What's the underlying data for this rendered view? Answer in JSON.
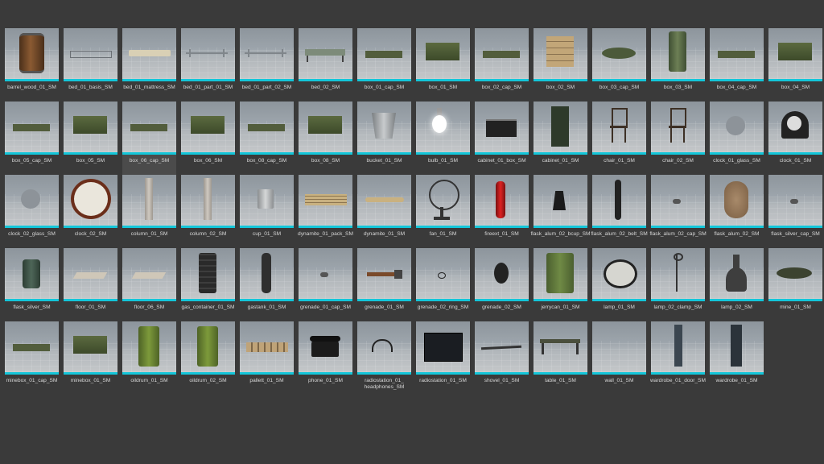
{
  "assets": [
    {
      "label": "barrel_wood_01_SM",
      "icon": "barrel-icon"
    },
    {
      "label": "bed_01_basis_SM",
      "icon": "bed-frame-icon"
    },
    {
      "label": "bed_01_mattress_SM",
      "icon": "mattress-icon"
    },
    {
      "label": "bed_01_part_01_SM",
      "icon": "bed-part-icon"
    },
    {
      "label": "bed_01_part_02_SM",
      "icon": "bed-part-icon"
    },
    {
      "label": "bed_02_SM",
      "icon": "cot-icon"
    },
    {
      "label": "box_01_cap_SM",
      "icon": "box-lid-icon"
    },
    {
      "label": "box_01_SM",
      "icon": "box-icon"
    },
    {
      "label": "box_02_cap_SM",
      "icon": "box-lid-icon"
    },
    {
      "label": "box_02_SM",
      "icon": "wooden-crate-icon"
    },
    {
      "label": "box_03_cap_SM",
      "icon": "round-lid-icon"
    },
    {
      "label": "box_03_SM",
      "icon": "cylinder-case-icon"
    },
    {
      "label": "box_04_cap_SM",
      "icon": "box-lid-icon"
    },
    {
      "label": "box_04_SM",
      "icon": "box-icon"
    },
    {
      "label": "box_05_cap_SM",
      "icon": "box-lid-icon"
    },
    {
      "label": "box_05_SM",
      "icon": "box-icon"
    },
    {
      "label": "box_06_cap_SM",
      "icon": "box-lid-icon"
    },
    {
      "label": "box_06_SM",
      "icon": "box-icon"
    },
    {
      "label": "box_08_cap_SM",
      "icon": "box-lid-icon"
    },
    {
      "label": "box_08_SM",
      "icon": "box-icon"
    },
    {
      "label": "bucket_01_SM",
      "icon": "bucket-icon"
    },
    {
      "label": "bulb_01_SM",
      "icon": "bulb-icon"
    },
    {
      "label": "cabinet_01_box_SM",
      "icon": "drawer-icon"
    },
    {
      "label": "cabinet_01_SM",
      "icon": "cabinet-icon"
    },
    {
      "label": "chair_01_SM",
      "icon": "chair-icon"
    },
    {
      "label": "chair_02_SM",
      "icon": "chair-icon"
    },
    {
      "label": "clock_01_glass_SM",
      "icon": "glass-disc-icon"
    },
    {
      "label": "clock_01_SM",
      "icon": "mantel-clock-icon"
    },
    {
      "label": "clock_02_glass_SM",
      "icon": "glass-disc-icon"
    },
    {
      "label": "clock_02_SM",
      "icon": "wall-clock-icon"
    },
    {
      "label": "column_01_SM",
      "icon": "column-icon"
    },
    {
      "label": "column_02_SM",
      "icon": "column-icon"
    },
    {
      "label": "cup_01_SM",
      "icon": "cup-icon"
    },
    {
      "label": "dynamite_01_pack_SM",
      "icon": "dynamite-pack-icon"
    },
    {
      "label": "dynamite_01_SM",
      "icon": "dynamite-icon"
    },
    {
      "label": "fan_01_SM",
      "icon": "fan-icon"
    },
    {
      "label": "fireext_01_SM",
      "icon": "fire-extinguisher-icon"
    },
    {
      "label": "flask_alum_02_bcup_SM",
      "icon": "flask-cup-icon"
    },
    {
      "label": "flask_alum_02_belt_SM",
      "icon": "belt-icon"
    },
    {
      "label": "flask_alum_02_cap_SM",
      "icon": "cap-icon"
    },
    {
      "label": "flask_alum_02_SM",
      "icon": "canteen-icon"
    },
    {
      "label": "flask_silver_cap_SM",
      "icon": "cap-icon"
    },
    {
      "label": "flask_silver_SM",
      "icon": "hip-flask-icon"
    },
    {
      "label": "floor_01_SM",
      "icon": "floor-tile-icon"
    },
    {
      "label": "floor_06_SM",
      "icon": "floor-tile-icon"
    },
    {
      "label": "gas_container_01_SM",
      "icon": "gas-container-icon"
    },
    {
      "label": "gastank_01_SM",
      "icon": "gas-tank-icon"
    },
    {
      "label": "grenade_01_cap_SM",
      "icon": "cap-icon"
    },
    {
      "label": "grenade_01_SM",
      "icon": "stick-grenade-icon"
    },
    {
      "label": "grenade_02_ring_SM",
      "icon": "ring-icon"
    },
    {
      "label": "grenade_02_SM",
      "icon": "grenade-icon"
    },
    {
      "label": "jerrycan_01_SM",
      "icon": "jerrycan-icon"
    },
    {
      "label": "lamp_01_SM",
      "icon": "cage-lamp-icon"
    },
    {
      "label": "lamp_02_clamp_SM",
      "icon": "lamp-clamp-icon"
    },
    {
      "label": "lamp_02_SM",
      "icon": "oil-lamp-icon"
    },
    {
      "label": "mine_01_SM",
      "icon": "landmine-icon"
    },
    {
      "label": "minebox_01_cap_SM",
      "icon": "box-lid-icon"
    },
    {
      "label": "minebox_01_SM",
      "icon": "box-icon"
    },
    {
      "label": "oildrum_01_SM",
      "icon": "oil-drum-icon"
    },
    {
      "label": "oildrum_02_SM",
      "icon": "oil-drum-icon"
    },
    {
      "label": "pallett_01_SM",
      "icon": "pallet-icon"
    },
    {
      "label": "phone_01_SM",
      "icon": "rotary-phone-icon"
    },
    {
      "label": "radiostation_01_\nheadphones_SM",
      "icon": "headphones-icon"
    },
    {
      "label": "radiostation_01_SM",
      "icon": "radio-station-icon"
    },
    {
      "label": "shovel_01_SM",
      "icon": "shovel-icon"
    },
    {
      "label": "table_01_SM",
      "icon": "table-icon"
    },
    {
      "label": "wall_01_SM",
      "icon": "wall-icon"
    },
    {
      "label": "wardrobe_01_door_SM",
      "icon": "wardrobe-door-icon"
    },
    {
      "label": "wardrobe_01_SM",
      "icon": "wardrobe-icon"
    }
  ],
  "highlighted_asset": "box_06_cap_SM",
  "colors": {
    "background": "#3a3a3a",
    "accent_bar": "#13c6d9",
    "label_text": "#d6d6d6"
  }
}
